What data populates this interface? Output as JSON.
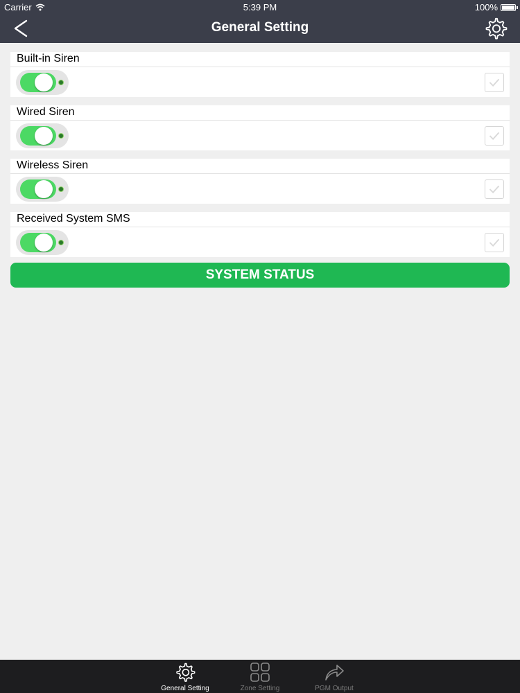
{
  "status_bar": {
    "carrier": "Carrier",
    "time": "5:39 PM",
    "battery": "100%"
  },
  "nav": {
    "title": "General Setting",
    "back_icon": "chevron-left-icon",
    "settings_icon": "gear-icon"
  },
  "settings": [
    {
      "label": "Built-in Siren",
      "enabled": true,
      "checked": false
    },
    {
      "label": "Wired Siren",
      "enabled": true,
      "checked": false
    },
    {
      "label": "Wireless Siren",
      "enabled": true,
      "checked": false
    },
    {
      "label": "Received System SMS",
      "enabled": true,
      "checked": false
    }
  ],
  "system_status_button": "SYSTEM STATUS",
  "tabs": [
    {
      "label": "General Setting",
      "icon": "gear-icon",
      "active": true
    },
    {
      "label": "Zone Setting",
      "icon": "grid-icon",
      "active": false
    },
    {
      "label": "PGM Output",
      "icon": "share-arrow-icon",
      "active": false
    }
  ],
  "colors": {
    "nav_bg": "#3b3e4a",
    "toggle_on": "#4cd964",
    "button_green": "#1fb853",
    "tab_bar_bg": "#1d1d1f"
  }
}
